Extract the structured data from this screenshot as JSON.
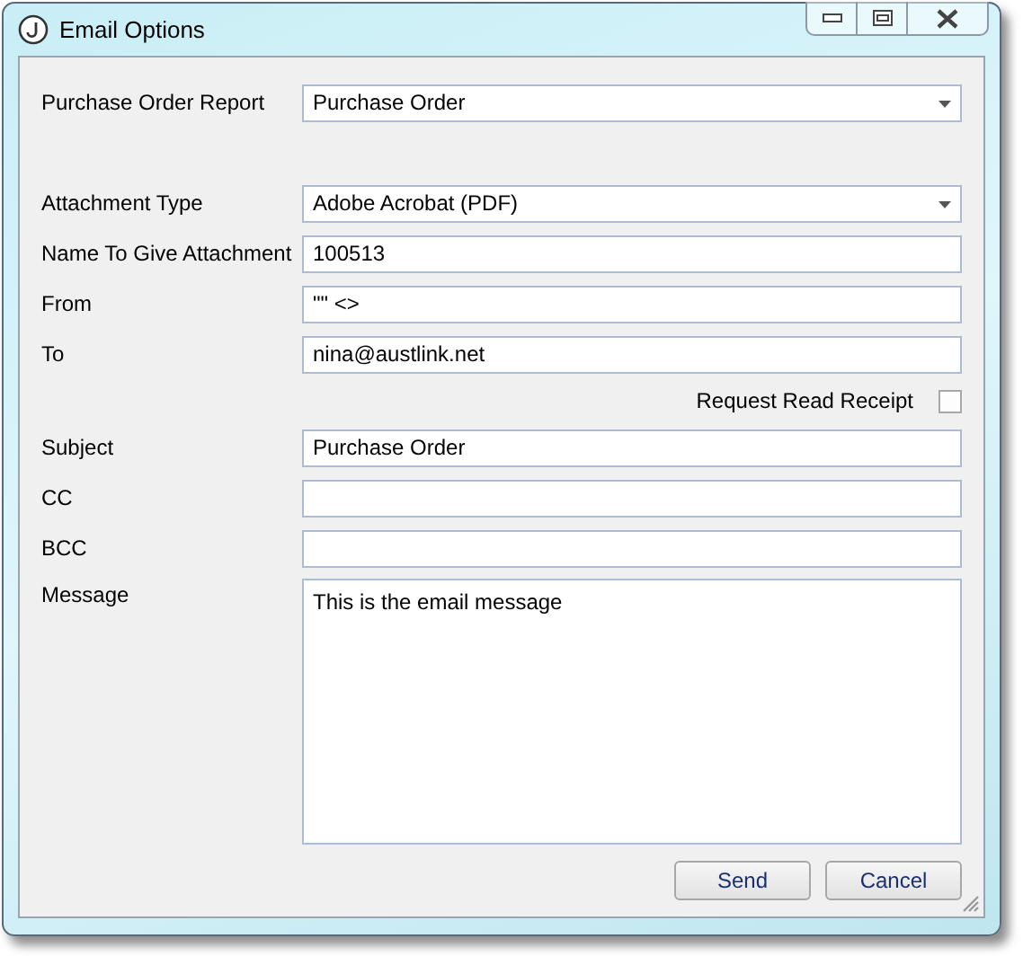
{
  "window": {
    "title": "Email Options"
  },
  "fields": [
    {
      "kind": "dropdown",
      "label": "Purchase Order Report",
      "value": "Purchase Order"
    },
    {
      "kind": "spacer"
    },
    {
      "kind": "dropdown",
      "label": "Attachment Type",
      "value": "Adobe Acrobat (PDF)"
    },
    {
      "kind": "text",
      "label": "Name To Give Attachment",
      "value": "100513"
    },
    {
      "kind": "text",
      "label": "From",
      "value": "\"\" <>"
    },
    {
      "kind": "text",
      "label": "To",
      "value": "nina@austlink.net"
    },
    {
      "kind": "checkbox",
      "label": "Request Read Receipt",
      "checked": false
    },
    {
      "kind": "text",
      "label": "Subject",
      "value": "Purchase Order"
    },
    {
      "kind": "text",
      "label": "CC"
    },
    {
      "kind": "text",
      "label": "BCC"
    },
    {
      "kind": "textarea",
      "label": "Message",
      "value": "This is the email message"
    }
  ],
  "buttons": [
    "Send",
    "Cancel"
  ]
}
